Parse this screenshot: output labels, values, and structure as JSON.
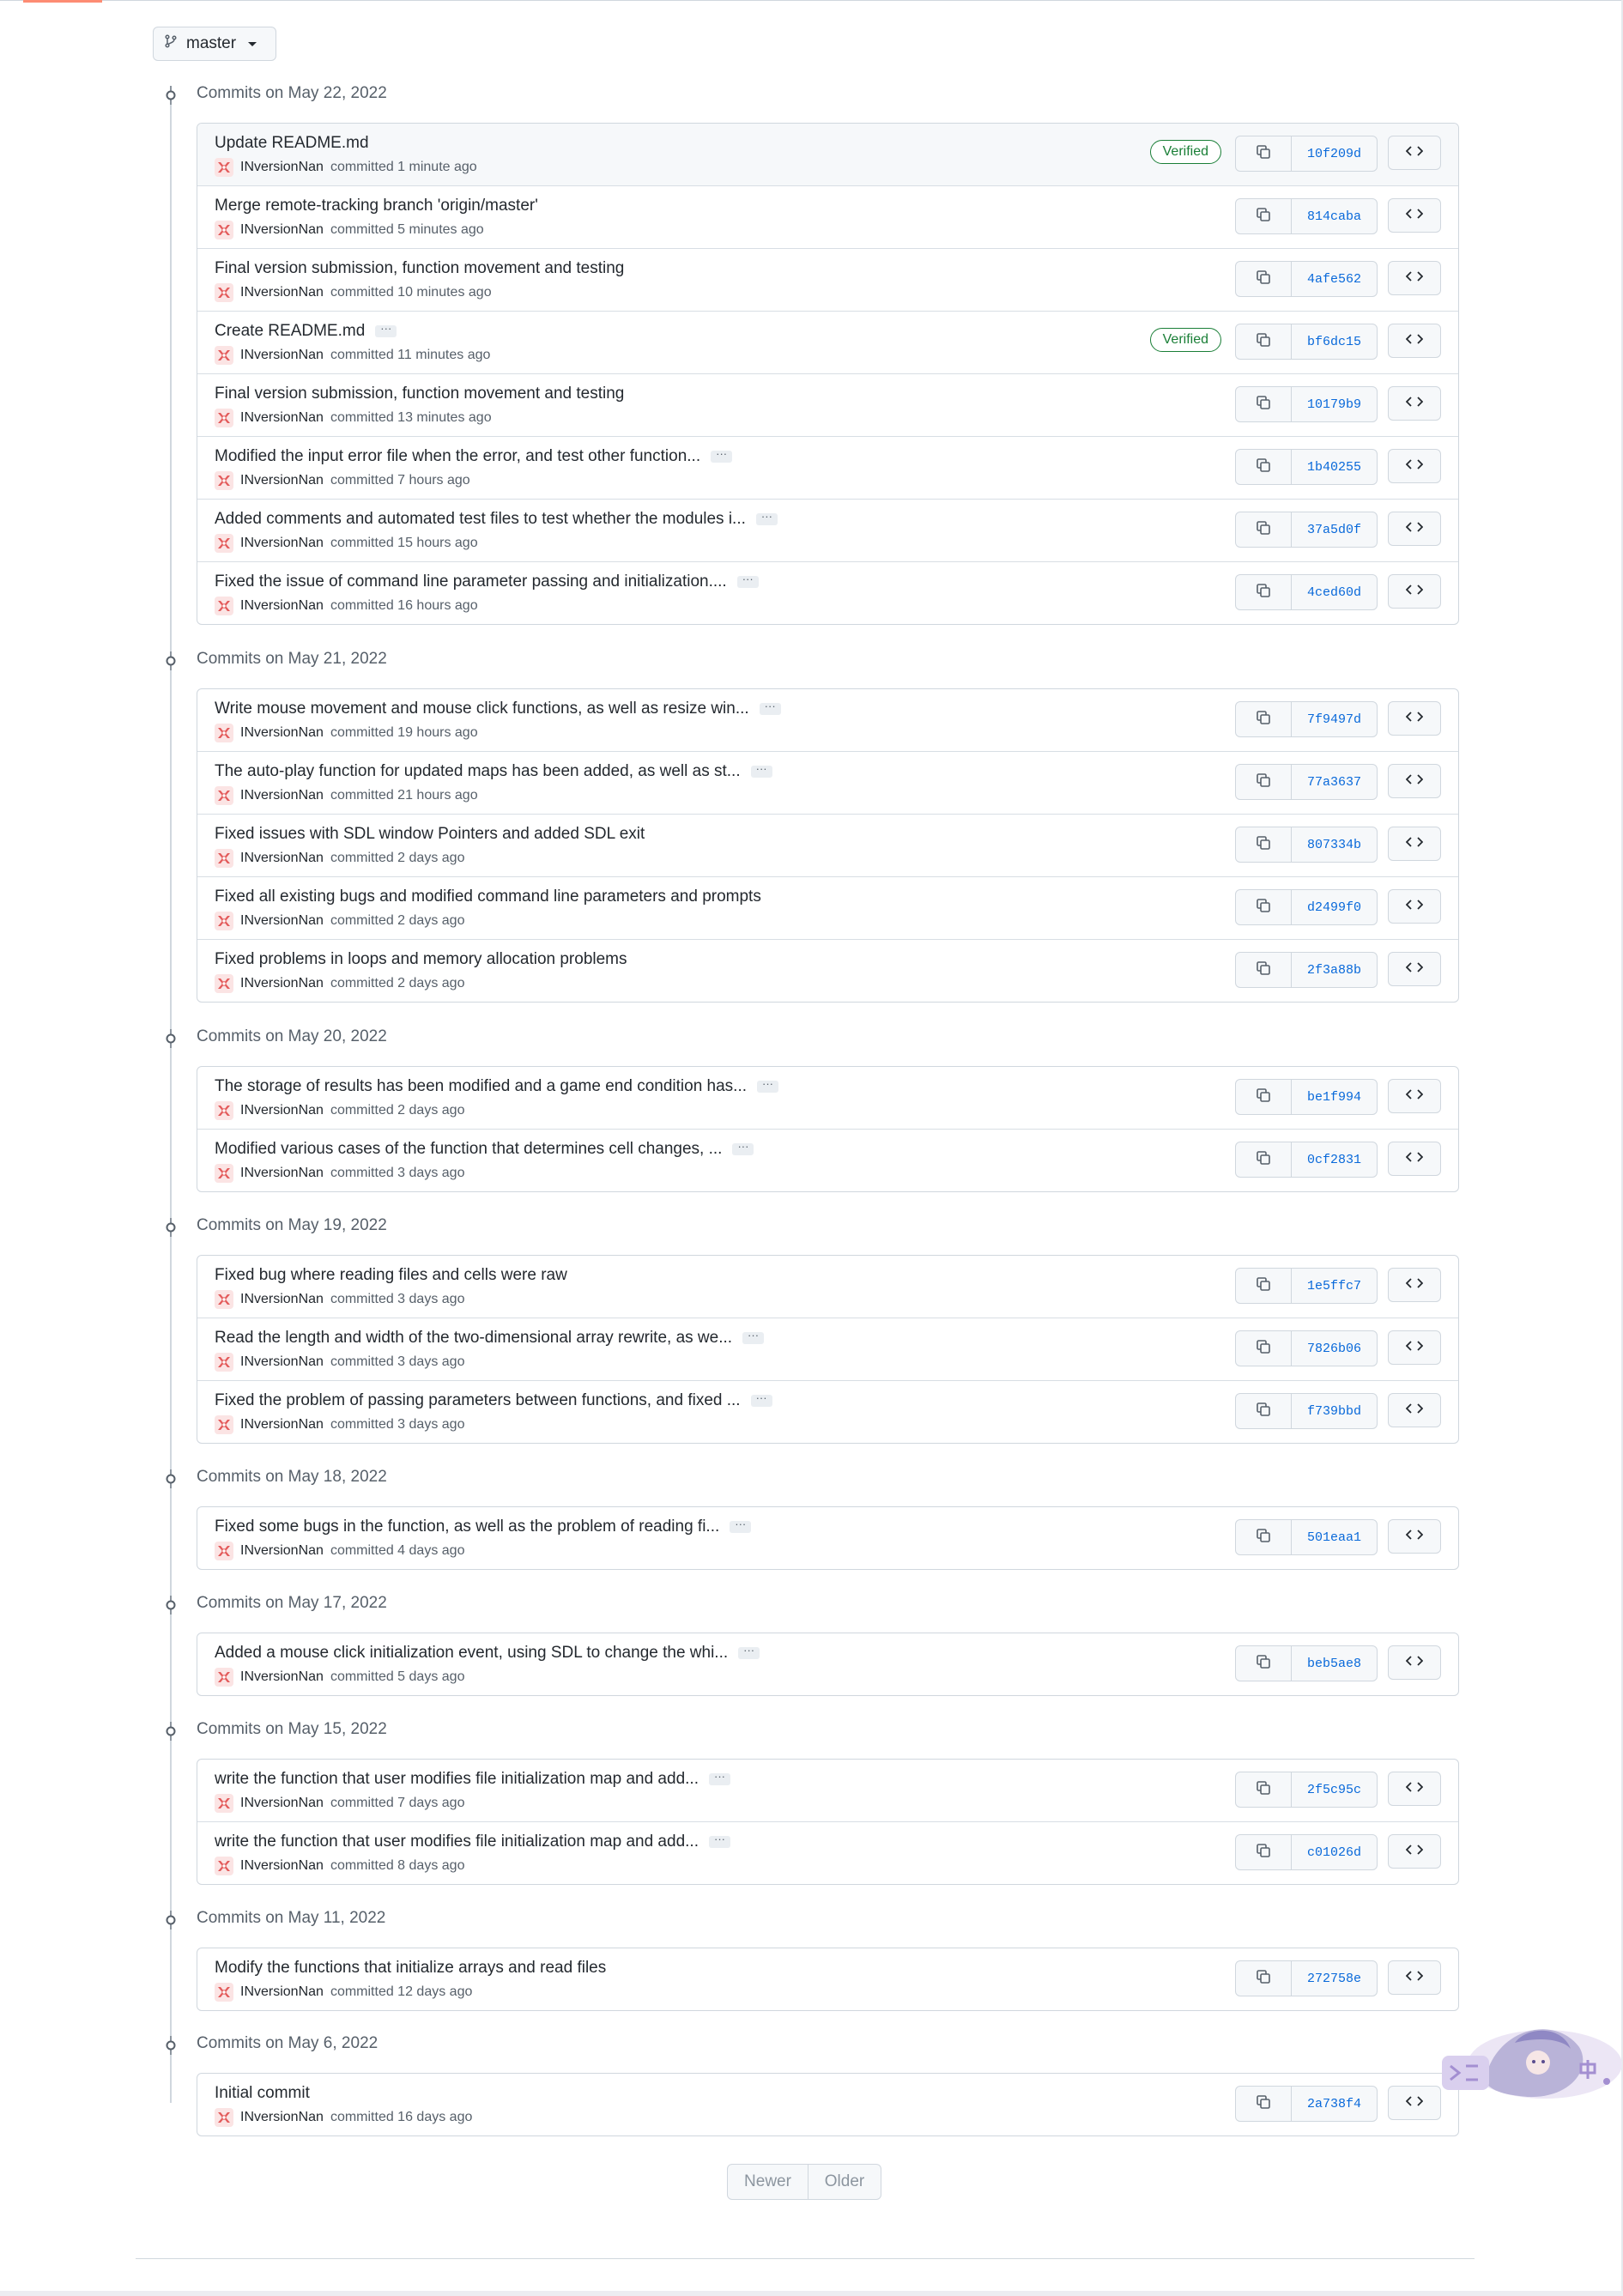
{
  "branch": {
    "label": "master"
  },
  "groups": [
    {
      "title": "Commits on May 22, 2022",
      "commits": [
        {
          "message": "Update README.md",
          "author": "INversionNan",
          "committed": "committed 1 minute ago",
          "sha": "10f209d",
          "verified": "Verified",
          "ellipsis": ""
        },
        {
          "message": "Merge remote-tracking branch 'origin/master'",
          "author": "INversionNan",
          "committed": "committed 5 minutes ago",
          "sha": "814caba",
          "verified": "",
          "ellipsis": ""
        },
        {
          "message": "Final version submission, function movement and testing",
          "author": "INversionNan",
          "committed": "committed 10 minutes ago",
          "sha": "4afe562",
          "verified": "",
          "ellipsis": ""
        },
        {
          "message": "Create README.md",
          "author": "INversionNan",
          "committed": "committed 11 minutes ago",
          "sha": "bf6dc15",
          "verified": "Verified",
          "ellipsis": "···"
        },
        {
          "message": "Final version submission, function movement and testing",
          "author": "INversionNan",
          "committed": "committed 13 minutes ago",
          "sha": "10179b9",
          "verified": "",
          "ellipsis": ""
        },
        {
          "message": "Modified the input error file when the error, and test other function...",
          "author": "INversionNan",
          "committed": "committed 7 hours ago",
          "sha": "1b40255",
          "verified": "",
          "ellipsis": "···"
        },
        {
          "message": "Added comments and automated test files to test whether the modules i...",
          "author": "INversionNan",
          "committed": "committed 15 hours ago",
          "sha": "37a5d0f",
          "verified": "",
          "ellipsis": "···"
        },
        {
          "message": "Fixed the issue of command line parameter passing and initialization....",
          "author": "INversionNan",
          "committed": "committed 16 hours ago",
          "sha": "4ced60d",
          "verified": "",
          "ellipsis": "···"
        }
      ]
    },
    {
      "title": "Commits on May 21, 2022",
      "commits": [
        {
          "message": "Write mouse movement and mouse click functions, as well as resize win...",
          "author": "INversionNan",
          "committed": "committed 19 hours ago",
          "sha": "7f9497d",
          "verified": "",
          "ellipsis": "···"
        },
        {
          "message": "The auto-play function for updated maps has been added, as well as st...",
          "author": "INversionNan",
          "committed": "committed 21 hours ago",
          "sha": "77a3637",
          "verified": "",
          "ellipsis": "···"
        },
        {
          "message": "Fixed issues with SDL window Pointers and added SDL exit",
          "author": "INversionNan",
          "committed": "committed 2 days ago",
          "sha": "807334b",
          "verified": "",
          "ellipsis": ""
        },
        {
          "message": "Fixed all existing bugs and modified command line parameters and prompts",
          "author": "INversionNan",
          "committed": "committed 2 days ago",
          "sha": "d2499f0",
          "verified": "",
          "ellipsis": ""
        },
        {
          "message": "Fixed problems in loops and memory allocation problems",
          "author": "INversionNan",
          "committed": "committed 2 days ago",
          "sha": "2f3a88b",
          "verified": "",
          "ellipsis": ""
        }
      ]
    },
    {
      "title": "Commits on May 20, 2022",
      "commits": [
        {
          "message": "The storage of results has been modified and a game end condition has...",
          "author": "INversionNan",
          "committed": "committed 2 days ago",
          "sha": "be1f994",
          "verified": "",
          "ellipsis": "···"
        },
        {
          "message": "Modified various cases of the function that determines cell changes, ...",
          "author": "INversionNan",
          "committed": "committed 3 days ago",
          "sha": "0cf2831",
          "verified": "",
          "ellipsis": "···"
        }
      ]
    },
    {
      "title": "Commits on May 19, 2022",
      "commits": [
        {
          "message": "Fixed bug where reading files and cells were raw",
          "author": "INversionNan",
          "committed": "committed 3 days ago",
          "sha": "1e5ffc7",
          "verified": "",
          "ellipsis": ""
        },
        {
          "message": "Read the length and width of the two-dimensional array rewrite, as we...",
          "author": "INversionNan",
          "committed": "committed 3 days ago",
          "sha": "7826b06",
          "verified": "",
          "ellipsis": "···"
        },
        {
          "message": "Fixed the problem of passing parameters between functions, and fixed ...",
          "author": "INversionNan",
          "committed": "committed 3 days ago",
          "sha": "f739bbd",
          "verified": "",
          "ellipsis": "···"
        }
      ]
    },
    {
      "title": "Commits on May 18, 2022",
      "commits": [
        {
          "message": "Fixed some bugs in the function, as well as the problem of reading fi...",
          "author": "INversionNan",
          "committed": "committed 4 days ago",
          "sha": "501eaa1",
          "verified": "",
          "ellipsis": "···"
        }
      ]
    },
    {
      "title": "Commits on May 17, 2022",
      "commits": [
        {
          "message": "Added a mouse click initialization event, using SDL to change the whi...",
          "author": "INversionNan",
          "committed": "committed 5 days ago",
          "sha": "beb5ae8",
          "verified": "",
          "ellipsis": "···"
        }
      ]
    },
    {
      "title": "Commits on May 15, 2022",
      "commits": [
        {
          "message": "write the function that user modifies file initialization map and add...",
          "author": "INversionNan",
          "committed": "committed 7 days ago",
          "sha": "2f5c95c",
          "verified": "",
          "ellipsis": "···"
        },
        {
          "message": "write the function that user modifies file initialization map and add...",
          "author": "INversionNan",
          "committed": "committed 8 days ago",
          "sha": "c01026d",
          "verified": "",
          "ellipsis": "···"
        }
      ]
    },
    {
      "title": "Commits on May 11, 2022",
      "commits": [
        {
          "message": "Modify the functions that initialize arrays and read files",
          "author": "INversionNan",
          "committed": "committed 12 days ago",
          "sha": "272758e",
          "verified": "",
          "ellipsis": ""
        }
      ]
    },
    {
      "title": "Commits on May 6, 2022",
      "commits": [
        {
          "message": "Initial commit",
          "author": "INversionNan",
          "committed": "committed 16 days ago",
          "sha": "2a738f4",
          "verified": "",
          "ellipsis": ""
        }
      ]
    }
  ],
  "pagination": {
    "newer": "Newer",
    "older": "Older"
  },
  "icons": {
    "branch": "git-branch-icon",
    "commit_node": "git-commit-icon",
    "copy": "copy-icon",
    "browse": "code-icon",
    "avatar": "avatar-icon"
  },
  "colors": {
    "link": "#0969da",
    "verified": "#1a7f37",
    "muted": "#57606a",
    "border": "#d0d7de",
    "accent_tab": "#fd8c73"
  }
}
